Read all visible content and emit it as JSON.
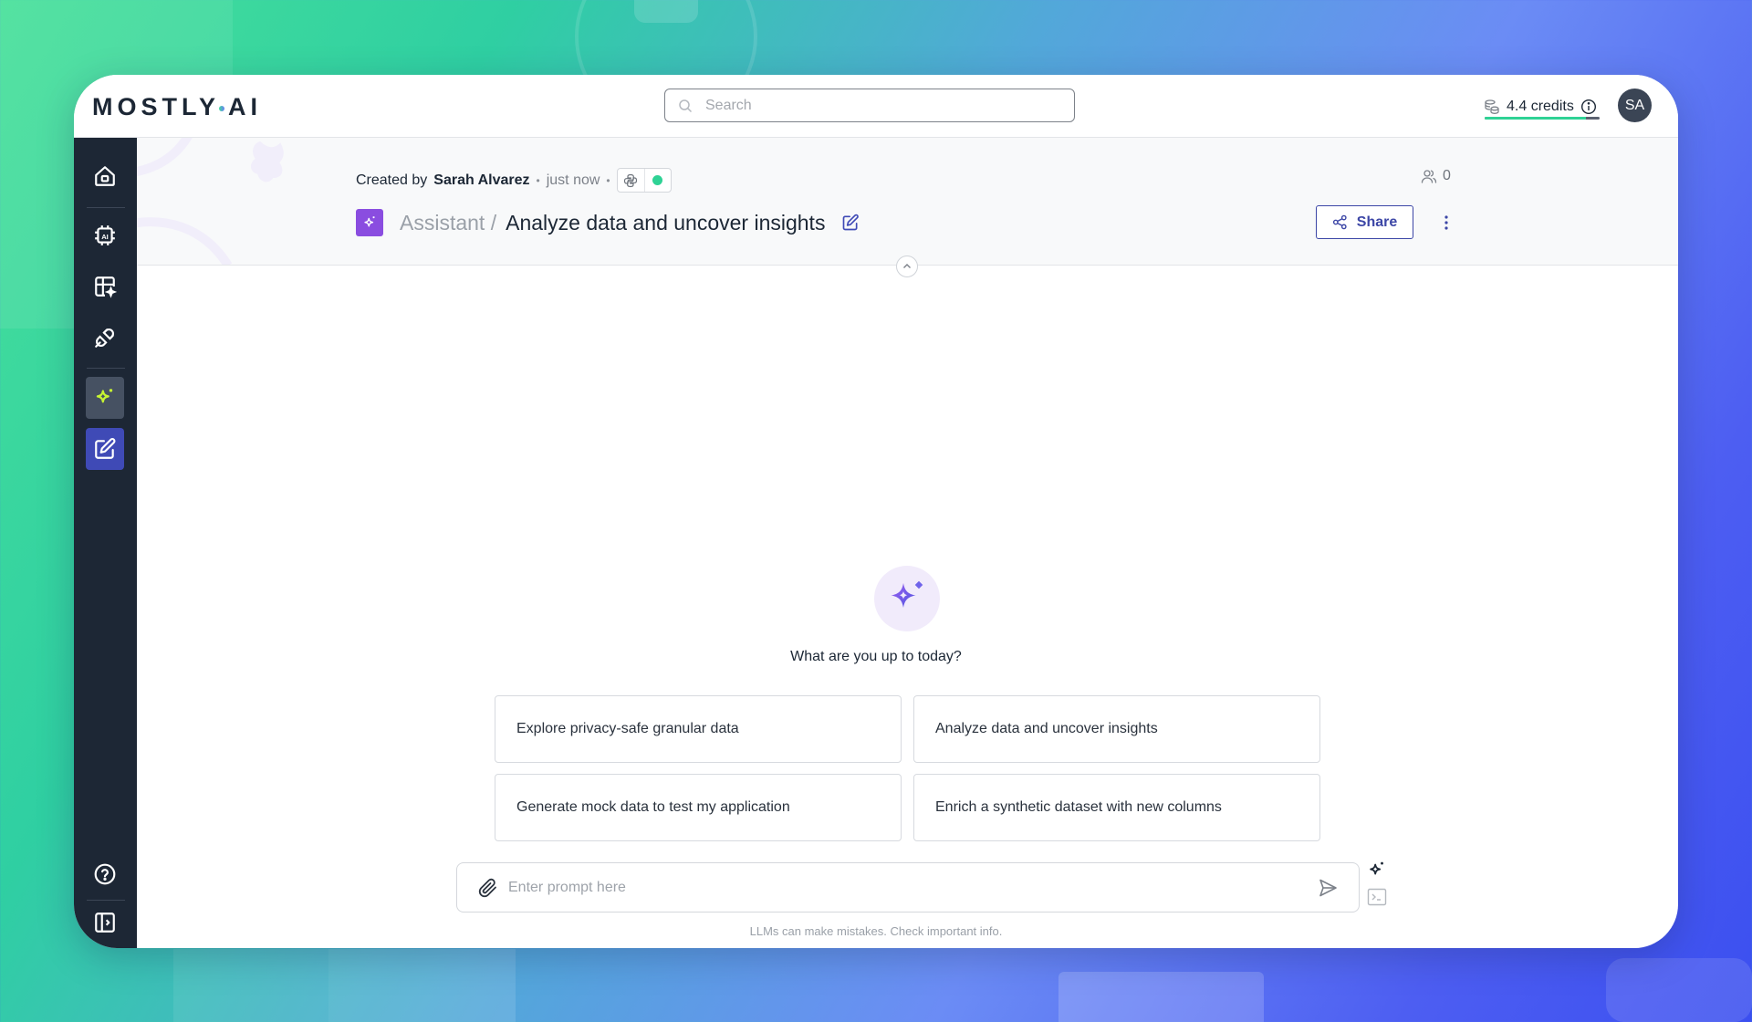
{
  "app": {
    "logo_left": "MOSTLY",
    "logo_right": "AI"
  },
  "search": {
    "placeholder": "Search",
    "value": ""
  },
  "credits": {
    "label": "4.4 credits",
    "usage_fraction": 0.88,
    "bar_color": "#2fd295"
  },
  "user": {
    "initials": "SA"
  },
  "sidebar": {
    "items": [
      {
        "name": "home",
        "icon": "home-icon"
      },
      {
        "name": "generators",
        "icon": "ai-chip-icon"
      },
      {
        "name": "synthetic-datasets",
        "icon": "table-sparkle-icon"
      },
      {
        "name": "connectors",
        "icon": "plug-icon"
      },
      {
        "name": "assistant",
        "icon": "sparkle-icon"
      },
      {
        "name": "new-session",
        "icon": "edit-icon",
        "active": true
      }
    ],
    "bottom": [
      {
        "name": "help",
        "icon": "help-icon"
      },
      {
        "name": "toggle-sidebar",
        "icon": "sidebar-toggle-icon"
      }
    ]
  },
  "header": {
    "created_by_label": "Created by",
    "author": "Sarah Alvarez",
    "time": "just now",
    "separator": "•",
    "collaborators_count": "0",
    "breadcrumb": "Assistant /",
    "title": "Analyze data and uncover insights",
    "share_label": "Share"
  },
  "main": {
    "hero_text": "What are you up to today?",
    "suggestions": [
      "Explore privacy-safe granular data",
      "Analyze data and uncover insights",
      "Generate mock data to test my application",
      "Enrich a synthetic dataset with new columns"
    ],
    "prompt_placeholder": "Enter prompt here",
    "prompt_value": "",
    "disclaimer": "LLMs can make mistakes. Check important info."
  },
  "colors": {
    "accent": "#3f4ab6",
    "sidebar_bg": "#1d2735",
    "assistant_purple": "#8a4de0",
    "status_green": "#2fd295"
  }
}
